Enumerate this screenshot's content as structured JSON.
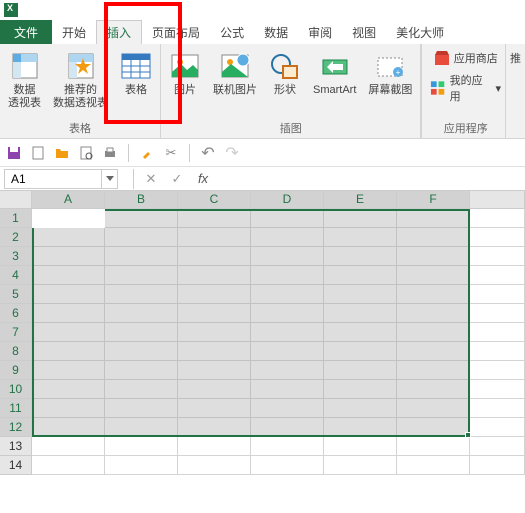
{
  "titlebar": {
    "app": "Excel"
  },
  "tabs": {
    "file": "文件",
    "home": "开始",
    "insert": "插入",
    "layout": "页面布局",
    "formulas": "公式",
    "data": "数据",
    "review": "审阅",
    "view": "视图",
    "beautify": "美化大师"
  },
  "ribbon": {
    "pivot": "数据\n透视表",
    "recommended_pivot": "推荐的\n数据透视表",
    "table": "表格",
    "picture": "图片",
    "online_picture": "联机图片",
    "shapes": "形状",
    "smartart": "SmartArt",
    "screenshot": "屏幕截图",
    "store": "应用商店",
    "my_apps": "我的应用",
    "addins_more": "推",
    "group_tables": "表格",
    "group_illustrations": "插图",
    "group_addins": "应用程序"
  },
  "formula_bar": {
    "name_box": "A1",
    "fx": "fx"
  },
  "grid": {
    "columns": [
      "A",
      "B",
      "C",
      "D",
      "E",
      "F"
    ],
    "row_count": 14,
    "selected_rows": 12,
    "selected_cols": 6,
    "active_cell": "A1"
  }
}
